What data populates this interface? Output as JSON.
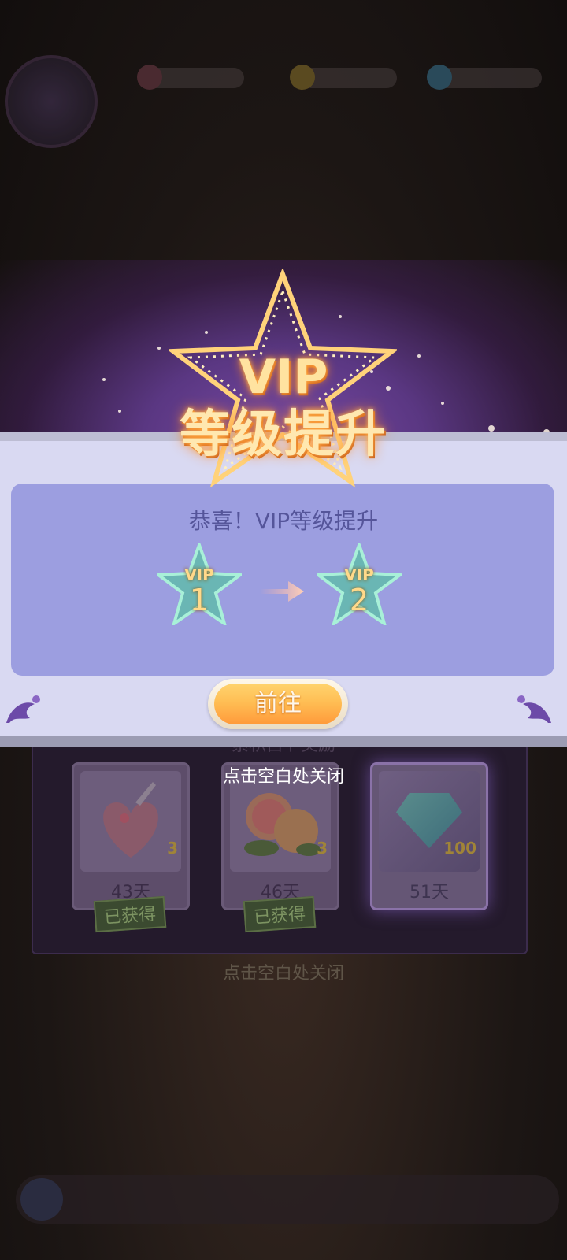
{
  "popup": {
    "title_line1": "VIP",
    "title_line2": "等级提升",
    "congrats_text": "恭喜！VIP等级提升",
    "level_from": {
      "label": "VIP",
      "number": "1"
    },
    "level_to": {
      "label": "VIP",
      "number": "2"
    },
    "go_button_label": "前往",
    "close_hint": "点击空白处关闭"
  },
  "background": {
    "reward_section_title": "累积占卜奖励",
    "reward_cards": [
      {
        "item_icon": "heart-potion-icon",
        "quantity": "3",
        "days_label": "43天",
        "status": "已获得"
      },
      {
        "item_icon": "grapefruit-icon",
        "quantity": "3",
        "days_label": "46天",
        "status": "已获得"
      },
      {
        "item_icon": "diamond-icon",
        "quantity": "100",
        "days_label": "51天",
        "status": ""
      }
    ],
    "close_hint": "点击空白处关闭"
  },
  "colors": {
    "modal_bg": "#d9d9f2",
    "panel_bg": "#9c9ee0",
    "button_orange": "#ffbe54",
    "title_gold": "#ffe3a0"
  }
}
